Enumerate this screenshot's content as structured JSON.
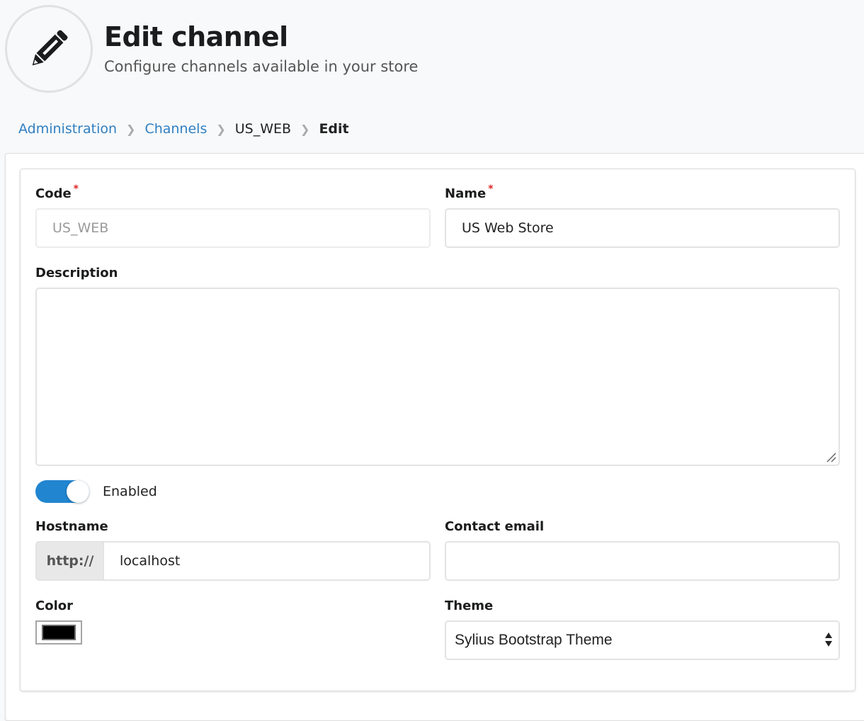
{
  "header": {
    "icon": "pencil-icon",
    "title": "Edit channel",
    "subtitle": "Configure channels available in your store"
  },
  "breadcrumb": [
    {
      "label": "Administration",
      "link": true
    },
    {
      "label": "Channels",
      "link": true
    },
    {
      "label": "US_WEB",
      "link": false
    },
    {
      "label": "Edit",
      "link": false,
      "active": true
    }
  ],
  "breadcrumb_separator_icon": "chevron-right-icon",
  "form": {
    "code": {
      "label": "Code",
      "required": "*",
      "value": "US_WEB",
      "disabled": true
    },
    "name": {
      "label": "Name",
      "required": "*",
      "value": "US Web Store"
    },
    "description": {
      "label": "Description",
      "value": ""
    },
    "enabled": {
      "label": "Enabled",
      "checked": true
    },
    "hostname": {
      "label": "Hostname",
      "prefix": "http://",
      "value": "localhost"
    },
    "contact_email": {
      "label": "Contact email",
      "value": ""
    },
    "color": {
      "label": "Color",
      "value": "#000000"
    },
    "theme": {
      "label": "Theme",
      "selected": "Sylius Bootstrap Theme"
    }
  },
  "colors": {
    "accent": "#2185d0",
    "link": "#2f7fc1",
    "required": "#db2828"
  }
}
